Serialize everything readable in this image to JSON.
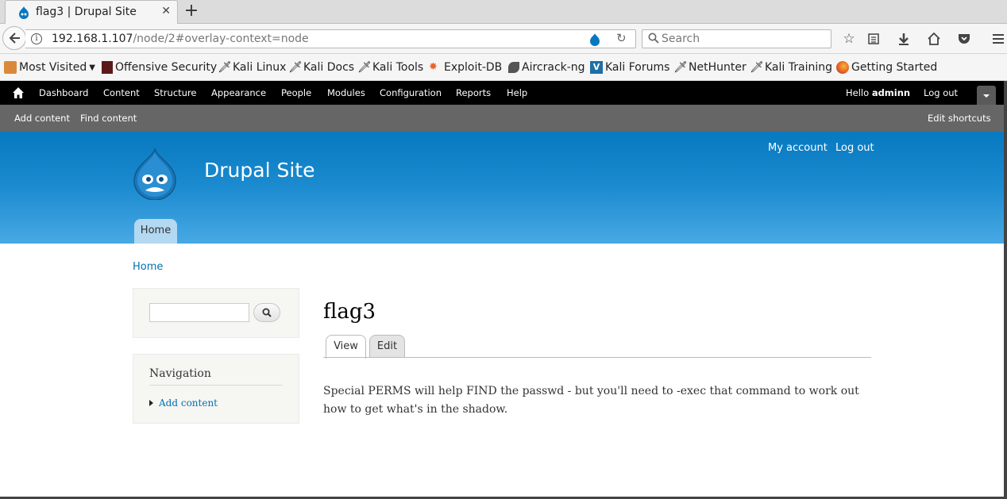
{
  "browser": {
    "tab_title": "flag3 | Drupal Site",
    "url_host": "192.168.1.107",
    "url_path": "/node/2#overlay-context=node",
    "search_placeholder": "Search",
    "bookmarks": [
      "Most Visited",
      "Offensive Security",
      "Kali Linux",
      "Kali Docs",
      "Kali Tools",
      "Exploit-DB",
      "Aircrack-ng",
      "Kali Forums",
      "NetHunter",
      "Kali Training",
      "Getting Started"
    ]
  },
  "toolbar": {
    "items": [
      "Dashboard",
      "Content",
      "Structure",
      "Appearance",
      "People",
      "Modules",
      "Configuration",
      "Reports",
      "Help"
    ],
    "hello_prefix": "Hello",
    "username": "adminn",
    "logout": "Log out"
  },
  "shortcuts": {
    "add_content": "Add content",
    "find_content": "Find content",
    "edit_shortcuts": "Edit shortcuts"
  },
  "header": {
    "site_name": "Drupal Site",
    "my_account": "My account",
    "logout": "Log out",
    "home_tab": "Home"
  },
  "breadcrumb": "Home",
  "sidebar": {
    "navigation_title": "Navigation",
    "nav_link": "Add content"
  },
  "node": {
    "title": "flag3",
    "tab_view": "View",
    "tab_edit": "Edit",
    "body": "Special PERMS will help FIND the passwd - but you'll need to -exec that command to work out how to get what's in the shadow."
  },
  "colors": {
    "drupal_blue": "#0779bf",
    "link": "#0071b3",
    "toolbar": "#000000",
    "shortcuts_bar": "#666666"
  }
}
